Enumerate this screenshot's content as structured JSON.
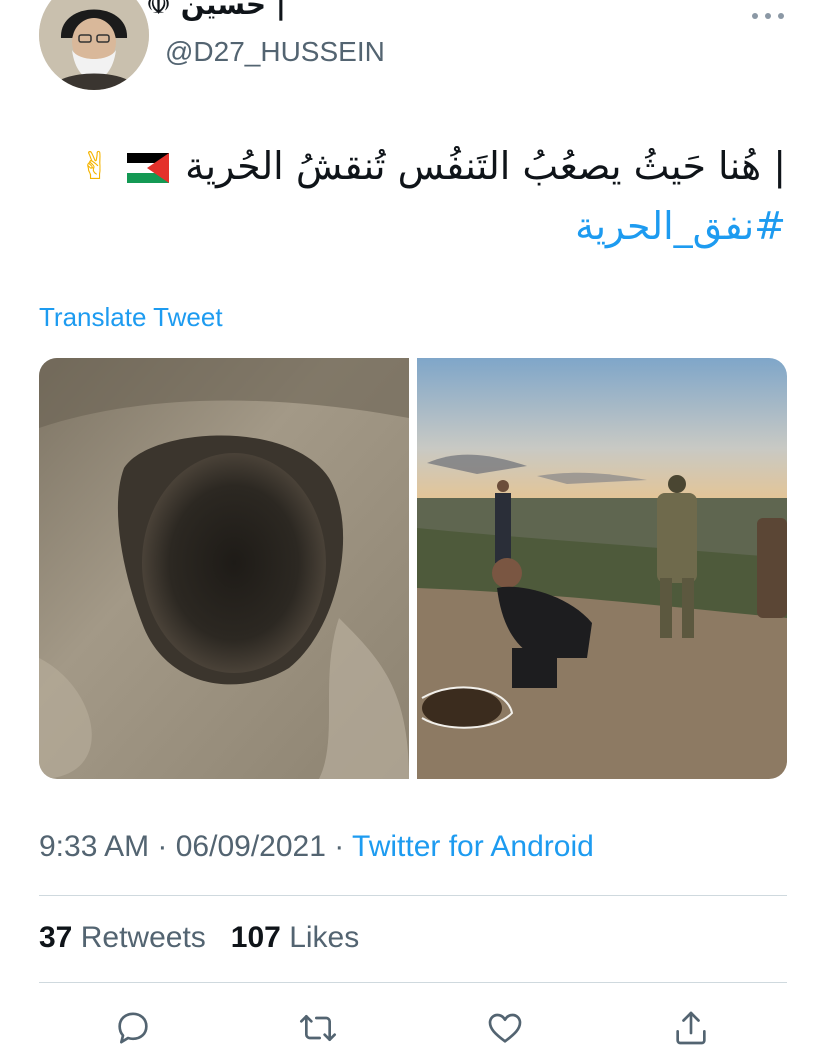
{
  "author": {
    "display_name": "| حسيْن ☫",
    "handle": "@D27_HUSSEIN"
  },
  "tweet": {
    "line1": "| هُنا حَيثُ يصعُبُ التَنفُس تُنقشُ الحُرية",
    "trailing_emoji": "✌",
    "flag_icon": "palestine-flag-icon",
    "hashtag": "#نفق_الحرية"
  },
  "translate_label": "Translate Tweet",
  "media": [
    {
      "icon": "tunnel-hole-photo"
    },
    {
      "icon": "men-at-tunnel-exit-photo"
    }
  ],
  "meta": {
    "time": "9:33 AM",
    "separator1": " · ",
    "date": "06/09/2021",
    "separator2": " · ",
    "source": "Twitter for Android"
  },
  "stats": {
    "retweets_count": "37",
    "retweets_label": "Retweets",
    "likes_count": "107",
    "likes_label": "Likes"
  },
  "colors": {
    "accent": "#1d9bf0",
    "secondary_text": "#536471",
    "divider": "#cfd9de"
  },
  "actions": [
    "reply-icon",
    "retweet-icon",
    "like-icon",
    "share-icon"
  ]
}
